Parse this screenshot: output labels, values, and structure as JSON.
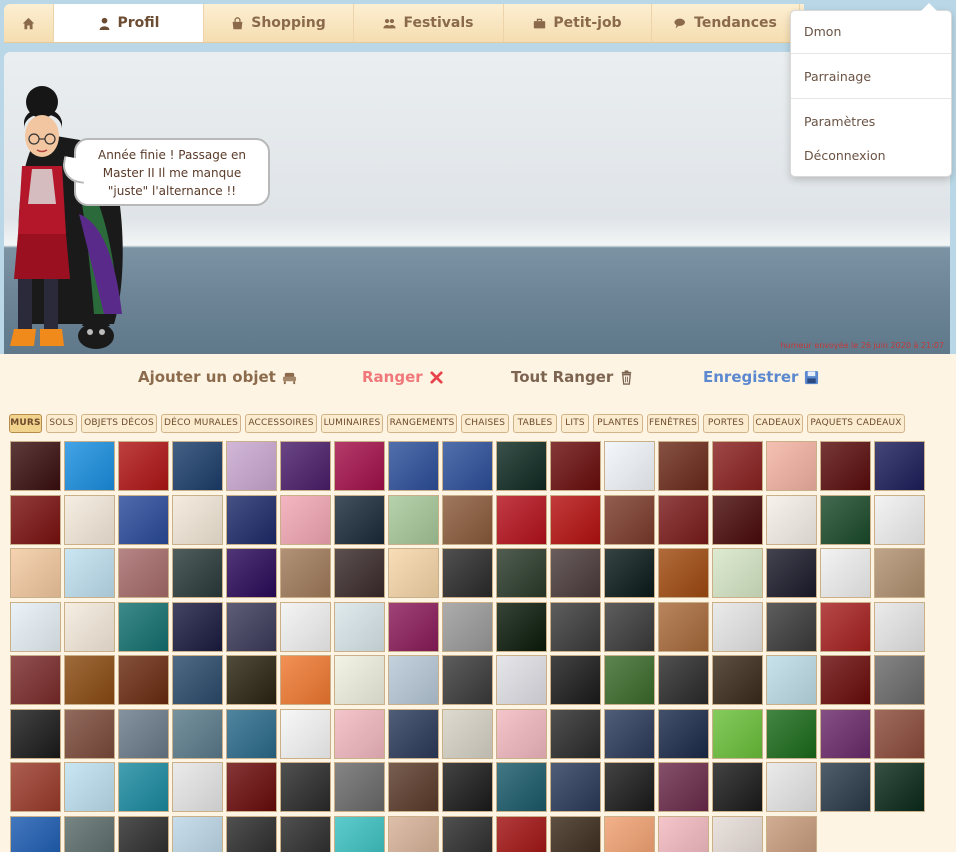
{
  "nav": {
    "home_label": "",
    "items": [
      {
        "label": "Profil",
        "icon": "user-icon",
        "active": true
      },
      {
        "label": "Shopping",
        "icon": "shopping-bag-icon",
        "active": false
      },
      {
        "label": "Festivals",
        "icon": "users-icon",
        "active": false
      },
      {
        "label": "Petit-job",
        "icon": "briefcase-icon",
        "active": false
      },
      {
        "label": "Tendances",
        "icon": "comments-icon",
        "active": false
      }
    ]
  },
  "dropdown": {
    "username": "Dmon",
    "items": [
      "Parrainage",
      "Paramètres",
      "Déconnexion"
    ]
  },
  "scene": {
    "mood": "Année finie ! Passage en Master II Il me manque \"juste\" l'alternance !!",
    "mood_date": "humeur envoyée le 26 juin 2020 à 21:07"
  },
  "actions": {
    "add": "Ajouter un objet",
    "store": "Ranger",
    "store_all": "Tout Ranger",
    "save": "Enregistrer"
  },
  "colors": {
    "add": "#8b6b4c",
    "store": "#f0787a",
    "store_all": "#7c6450",
    "save": "#5b88cf",
    "accent": "#f2d38e"
  },
  "categories": [
    "MURS",
    "SOLS",
    "OBJETS DÉCOS",
    "DÉCO MURALES",
    "ACCESSOIRES",
    "LUMINAIRES",
    "RANGEMENTS",
    "CHAISES",
    "TABLES",
    "LITS",
    "PLANTES",
    "FENÊTRES",
    "PORTES",
    "CADEAUX",
    "PAQUETS CADEAUX"
  ],
  "active_category": "MURS",
  "tiles": [
    "#3a0f0f",
    "#1a8fe0",
    "#b01515",
    "#1b3d6a",
    "#c9a7d0",
    "#4a1d6a",
    "#a3104a",
    "#2c4f9a",
    "#2c4f9a",
    "#0f2a22",
    "#6a0c0c",
    "#f2f6fa",
    "#6b2a1a",
    "#8a2020",
    "#f3b2a2",
    "#5a0c0c",
    "#1c1d5a",
    "#7a1010",
    "#f5eadc",
    "#2a4a9a",
    "#f2e8d8",
    "#1d2a6a",
    "#f2a6b4",
    "#1a2a3a",
    "#a6c89a",
    "#8a5a3a",
    "#b5101c",
    "#b51010",
    "#7a3a2a",
    "#7a1a1a",
    "#4a0a0a",
    "#f5efe8",
    "#1a4a2a",
    "#f0f0f0",
    "#f3c9a0",
    "#bfe0f0",
    "#a66a6a",
    "#2a3a3a",
    "#2a0a5a",
    "#a07a5a",
    "#3a2a2a",
    "#f6d6a8",
    "#2a2a2a",
    "#2a3a2a",
    "#4a3a3a",
    "#0a1a1a",
    "#a04a10",
    "#d6e6c6",
    "#1a1a2a",
    "#f0f0f0",
    "#b09070",
    "#e6f0f6",
    "#f5eadc",
    "#137070",
    "#1a1a40",
    "#3a3a5a",
    "#f2f2f2",
    "#d9e6ea",
    "#8a1a5a",
    "#9a9a9a",
    "#0a1a0a",
    "#3a3a3a",
    "#3a3a3a",
    "#a86a3a",
    "#e6e6e6",
    "#3a3a3a",
    "#a62020",
    "#e6e6e6",
    "#7a2a2a",
    "#8a4a10",
    "#6a2a10",
    "#2a4a6a",
    "#2a2410",
    "#f07830",
    "#f0f0e0",
    "#b6c8d6",
    "#3a3a3a",
    "#e0e0e6",
    "#1a1a1a",
    "#3a6a2a",
    "#2a2a2a",
    "#3a2a1a",
    "#bcdce6",
    "#6a0a0a",
    "#6a6a6a",
    "#1a1a1a",
    "#7a4a3a",
    "#6a7a8a",
    "#5a7a8a",
    "#2a6a8a",
    "#f6f6f6",
    "#f2b8c0",
    "#2a3a5a",
    "#d6d2c6",
    "#f2b8c0",
    "#2a2a2a",
    "#2a3a5a",
    "#1a2a4a",
    "#6ac03a",
    "#1a6a1a",
    "#6a2a6a",
    "#8a4a3a",
    "#9a3a2a",
    "#bde0f0",
    "#1a8aa0",
    "#e6e6e6",
    "#6a0a0a",
    "#2a2a2a",
    "#6a6a6a",
    "#5a3a2a",
    "#1a1a1a",
    "#1a5a6a",
    "#2a3a5a",
    "#1a1a1a",
    "#6a2a4a",
    "#1a1a1a",
    "#e6e6e6",
    "#2a3a4a",
    "#0a2a1a",
    "#1a5ab0",
    "#5a6a6a",
    "#2a2a2a",
    "#bcd6e6",
    "#2a2a2a",
    "#2a2a2a",
    "#3ac0c0",
    "#d6b096",
    "#2a2a2a",
    "#a01010",
    "#3a2a1a",
    "#f0a070",
    "#f2b8c0",
    "#e6dcd6",
    "#c69a7a"
  ]
}
